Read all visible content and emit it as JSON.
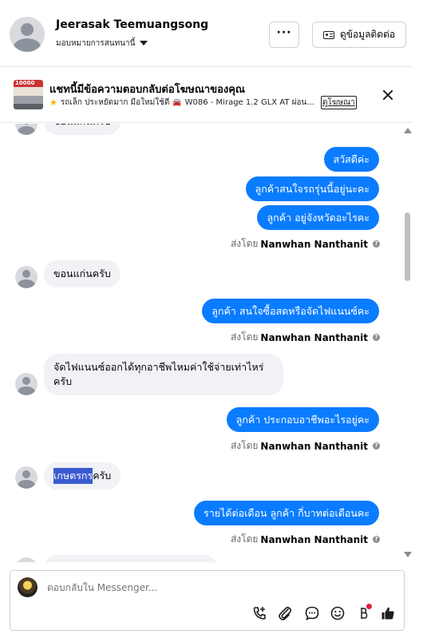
{
  "header": {
    "contact_name": "Jeerasak Teemuangsong",
    "assign_label": "มอบหมายการสนทนานี้",
    "more_label": "···",
    "contact_info_label": "ดูข้อมูลติดต่อ"
  },
  "ad_banner": {
    "thumb_text": "10000",
    "title": "แชทนี้มีข้อความตอบกลับต่อโฆษณาของคุณ",
    "subtitle": "รถเล็ก ประหยัดมาก มือใหม่ใช้ดี",
    "vehicle": "W086 - Mirage 1.2 GLX AT ผ่อน...",
    "link_label": "ดูโฆษณา"
  },
  "messages": [
    {
      "dir": "in",
      "text": "ขอนแก่นครับ",
      "partial": true
    },
    {
      "dir": "out",
      "text": "สวัสดีค่ะ"
    },
    {
      "dir": "out",
      "text": "ลูกค้าสนใจรถรุ่นนี้อยู่นะคะ"
    },
    {
      "dir": "out",
      "text": "ลูกค้า อยู่จังหวัดอะไรคะ"
    },
    {
      "sent_by_prefix": "ส่งโดย",
      "sent_by_name": "Nanwhan Nanthanit"
    },
    {
      "dir": "in",
      "text": "ขอนแก่นครับ"
    },
    {
      "dir": "out",
      "text": "ลูกค้า สนใจซื้อสดหรือจัดไฟแนนซ์คะ"
    },
    {
      "sent_by_prefix": "ส่งโดย",
      "sent_by_name": "Nanwhan Nanthanit"
    },
    {
      "dir": "in",
      "text": "จัดไฟแนนซ์ออกได้ทุกอาชีพไหมค่าใช้จ่ายเท่าไหร่ครับ"
    },
    {
      "dir": "out",
      "text": "ลูกค้า ประกอบอาชีพอะไรอยู่คะ"
    },
    {
      "sent_by_prefix": "ส่งโดย",
      "sent_by_name": "Nanwhan Nanthanit"
    },
    {
      "dir": "in",
      "text_highlight": "เกษตรกร",
      "text_rest": "ครับ"
    },
    {
      "dir": "out",
      "text": "รายได้ต่อเดือน ลูกค้า กี่บาทต่อเดือนคะ"
    },
    {
      "sent_by_prefix": "ส่งโดย",
      "sent_by_name": "Nanwhan Nanthanit"
    }
  ],
  "composer": {
    "placeholder": "ตอบกลับใน Messenger..."
  },
  "icons": {
    "accent": "#0a7cff",
    "badge": "#e41e3f",
    "tools": [
      "add-call-icon",
      "attachment-icon",
      "quick-reply-icon",
      "emoji-icon",
      "payment-icon",
      "like-icon"
    ]
  }
}
